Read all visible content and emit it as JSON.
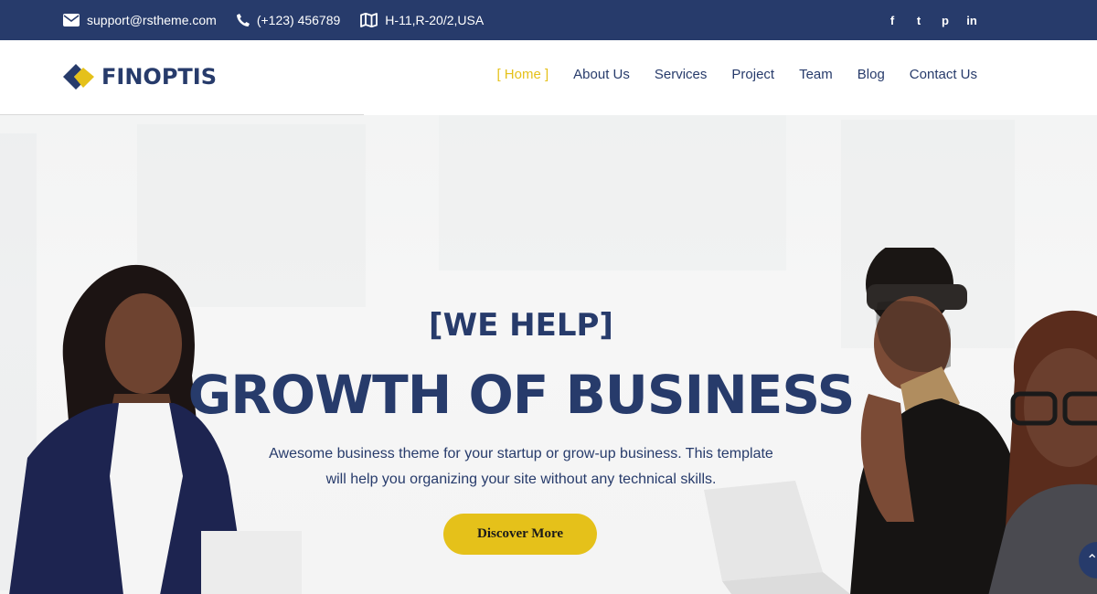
{
  "topbar": {
    "email": "support@rstheme.com",
    "phone": "(+123) 456789",
    "address": "H-11,R-20/2,USA",
    "social": [
      {
        "icon": "facebook-icon",
        "glyph": "f"
      },
      {
        "icon": "twitter-icon",
        "glyph": "t"
      },
      {
        "icon": "pinterest-icon",
        "glyph": "p"
      },
      {
        "icon": "linkedin-icon",
        "glyph": "in"
      }
    ]
  },
  "header": {
    "logo_text": "FINOPTIS",
    "nav": {
      "home": "[ Home ]",
      "about": "About Us",
      "services": "Services",
      "project": "Project",
      "team": "Team",
      "blog": "Blog",
      "contact": "Contact Us"
    }
  },
  "hero": {
    "eyebrow": "[WE HELP]",
    "headline": "GROWTH OF BUSINESS",
    "description": "Awesome business theme for your startup or grow-up business. This template will help you organizing your site without any technical skills.",
    "cta_label": "Discover More",
    "scroll_top_glyph": "⌃"
  },
  "colors": {
    "navy": "#273b6b",
    "accent": "#e5c11a",
    "white": "#ffffff"
  }
}
